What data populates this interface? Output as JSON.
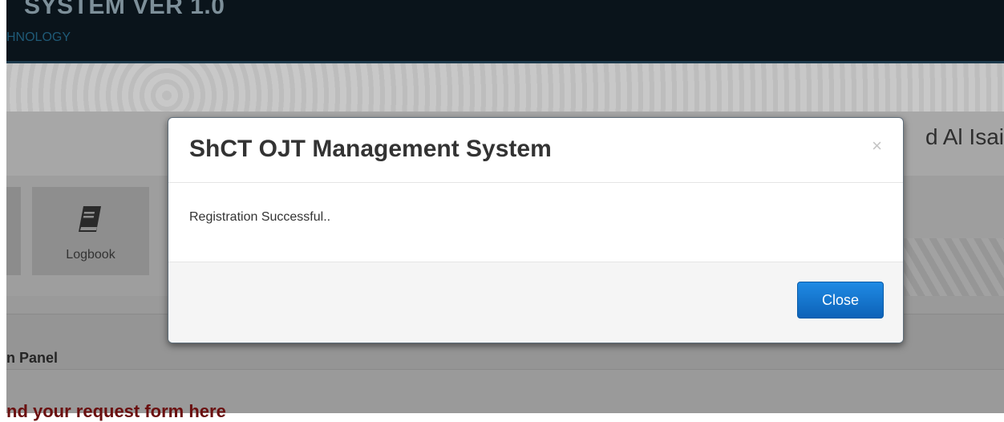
{
  "background": {
    "header": {
      "title": "SYSTEM VER 1.0",
      "subtitle": "HNOLOGY"
    },
    "user": {
      "name": "d Al Isai"
    },
    "nav": {
      "logbook_label": "Logbook",
      "logbook_icon": "book-icon"
    },
    "panel": {
      "title": "n Panel",
      "subtitle": "nd your request form here"
    }
  },
  "modal": {
    "title": "ShCT OJT Management System",
    "close_symbol": "×",
    "message": "Registration Successful..",
    "close_button_label": "Close"
  },
  "colors": {
    "header_bg": "#0a141b",
    "button_primary": "#1f8ae4",
    "panel_subtitle": "#6a0f0f"
  }
}
